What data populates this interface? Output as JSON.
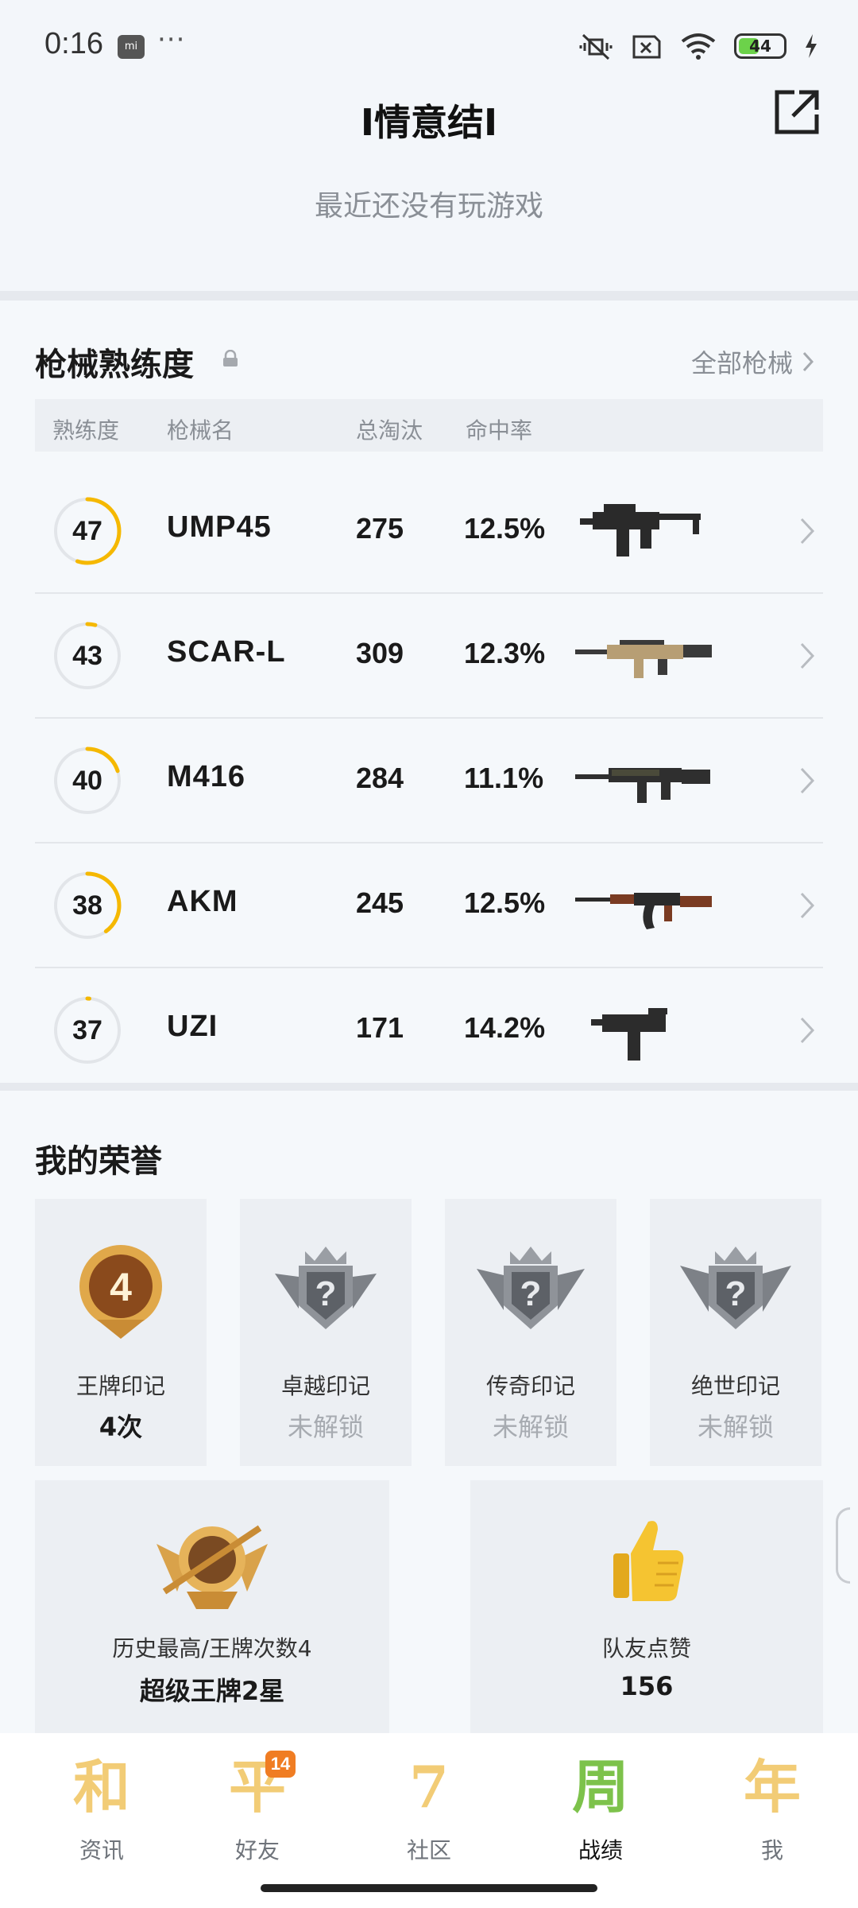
{
  "status_bar": {
    "time": "0:16",
    "app_icon": "mi",
    "dots": "···",
    "battery": "44"
  },
  "header": {
    "title": "I情意结I",
    "subtitle": "最近还没有玩游戏"
  },
  "weapons": {
    "title": "枪械熟练度",
    "all_link": "全部枪械",
    "columns": [
      "熟练度",
      "枪械名",
      "总淘汰",
      "命中率"
    ],
    "rows": [
      {
        "level": "47",
        "progress": 0.55,
        "name": "UMP45",
        "kills": "275",
        "hit_rate": "12.5%",
        "image": "smg-icon"
      },
      {
        "level": "43",
        "progress": 0.04,
        "name": "SCAR-L",
        "kills": "309",
        "hit_rate": "12.3%",
        "image": "assault-rifle-icon"
      },
      {
        "level": "40",
        "progress": 0.2,
        "name": "M416",
        "kills": "284",
        "hit_rate": "11.1%",
        "image": "assault-rifle-icon"
      },
      {
        "level": "38",
        "progress": 0.4,
        "name": "AKM",
        "kills": "245",
        "hit_rate": "12.5%",
        "image": "ak-rifle-icon"
      },
      {
        "level": "37",
        "progress": 0.01,
        "name": "UZI",
        "kills": "171",
        "hit_rate": "14.2%",
        "image": "uzi-icon"
      }
    ]
  },
  "honors": {
    "title": "我的荣誉",
    "badges": [
      {
        "label": "王牌印记",
        "value": "4次",
        "locked": false,
        "icon_text": "4"
      },
      {
        "label": "卓越印记",
        "value": "未解锁",
        "locked": true,
        "icon_text": "?"
      },
      {
        "label": "传奇印记",
        "value": "未解锁",
        "locked": true,
        "icon_text": "?"
      },
      {
        "label": "绝世印记",
        "value": "未解锁",
        "locked": true,
        "icon_text": "?"
      }
    ],
    "highest": {
      "label": "历史最高/王牌次数4",
      "value": "超级王牌2星"
    },
    "likes": {
      "label": "队友点赞",
      "value": "156"
    }
  },
  "bottom_nav": [
    {
      "label": "资讯",
      "glyph": "和",
      "badge": ""
    },
    {
      "label": "好友",
      "glyph": "平",
      "badge": "14"
    },
    {
      "label": "社区",
      "glyph": "7",
      "badge": ""
    },
    {
      "label": "战绩",
      "glyph": "周",
      "badge": "",
      "active": true
    },
    {
      "label": "我",
      "glyph": "年",
      "badge": ""
    }
  ],
  "colors": {
    "accent_ring": "#f5b800",
    "ring_track": "#e2e5e9",
    "badge_orange": "#f07d23"
  }
}
